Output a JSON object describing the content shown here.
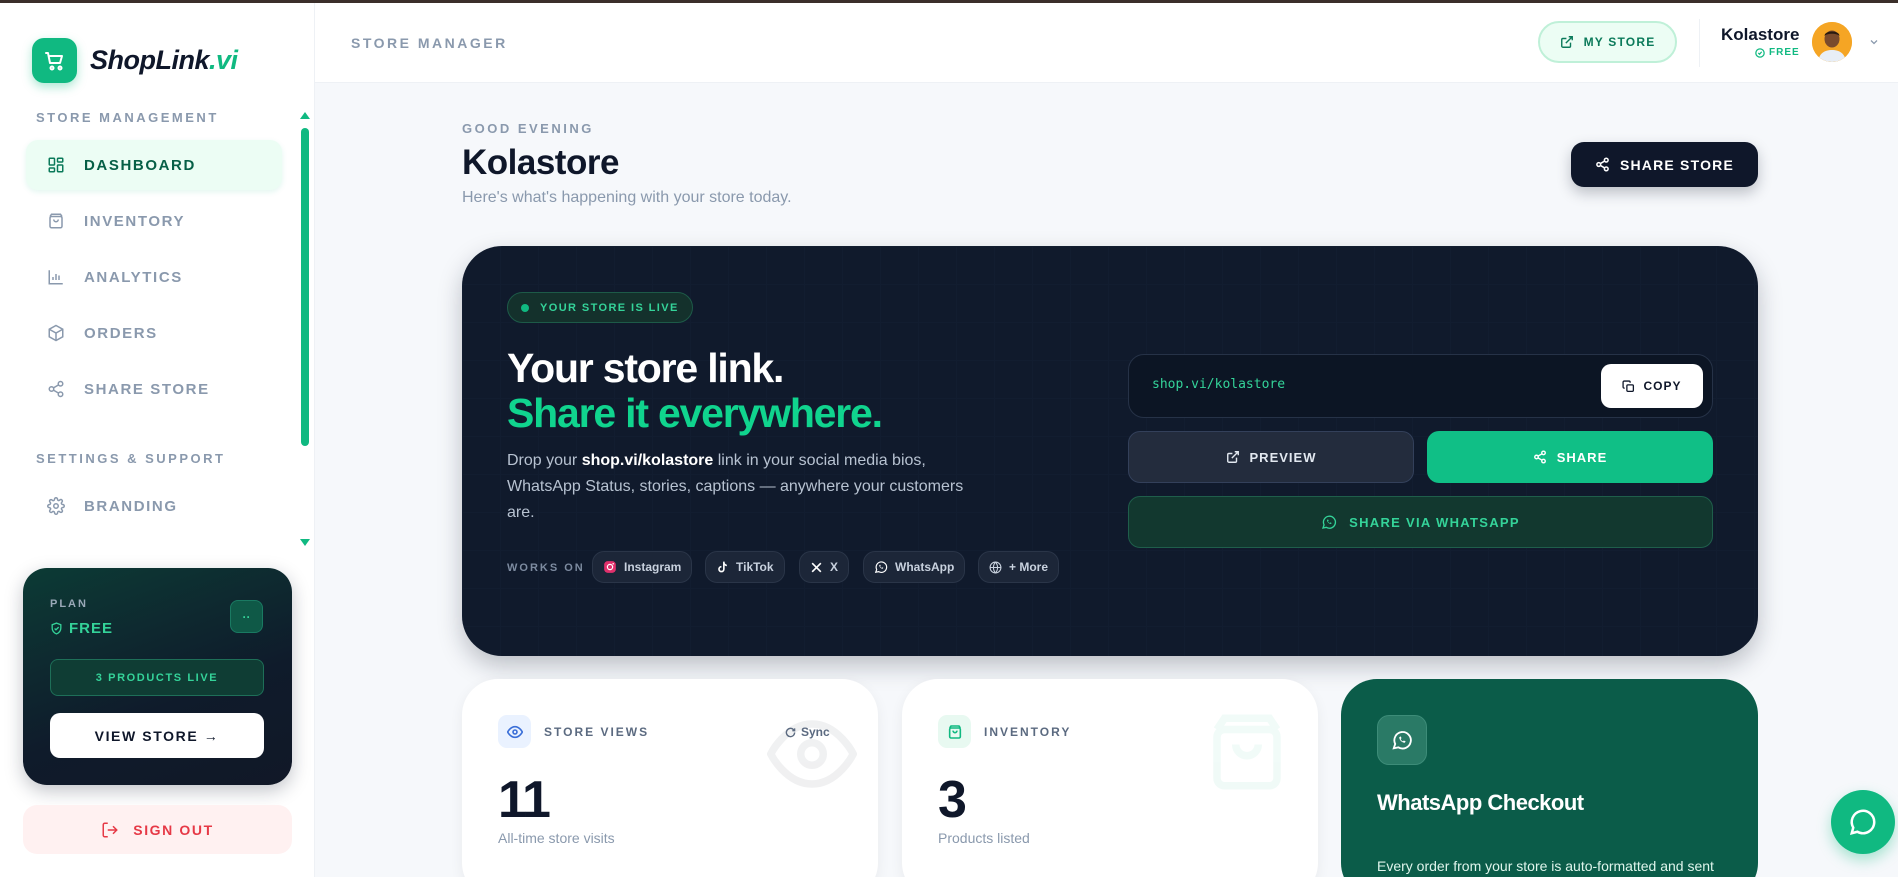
{
  "brand": {
    "name_main": "ShopLink",
    "name_accent": ".vi",
    "accent_color": "#10b981",
    "dark_color": "#0f172a"
  },
  "sidebar": {
    "section_store": "STORE MANAGEMENT",
    "section_settings": "SETTINGS & SUPPORT",
    "items": [
      {
        "label": "DASHBOARD",
        "icon": "grid-icon",
        "active": true
      },
      {
        "label": "INVENTORY",
        "icon": "bag-icon",
        "active": false
      },
      {
        "label": "ANALYTICS",
        "icon": "bar-chart-icon",
        "active": false
      },
      {
        "label": "ORDERS",
        "icon": "box-icon",
        "active": false
      },
      {
        "label": "SHARE STORE",
        "icon": "share-icon",
        "active": false
      }
    ],
    "settings_items": [
      {
        "label": "BRANDING",
        "icon": "gear-icon"
      }
    ],
    "plan": {
      "label": "PLAN",
      "name": "FREE",
      "button_glyph": "··",
      "products_live": "3 PRODUCTS LIVE",
      "view_store": "VIEW STORE →"
    },
    "sign_out": "SIGN OUT"
  },
  "topbar": {
    "breadcrumb": "STORE MANAGER",
    "my_store": "MY STORE",
    "user_name": "Kolastore",
    "user_plan": "FREE"
  },
  "main": {
    "greeting": "GOOD EVENING",
    "title": "Kolastore",
    "subtitle": "Here's what's happening with your store today.",
    "share_store": "SHARE STORE"
  },
  "hero": {
    "badge": "YOUR STORE IS LIVE",
    "headline_1": "Your store link.",
    "headline_2": "Share it everywhere.",
    "desc_pre": "Drop your ",
    "desc_link": "shop.vi/kolastore",
    "desc_post": " link in your social media bios, WhatsApp Status, stories, captions — anywhere your customers are.",
    "works_on": "WORKS ON",
    "platforms": [
      {
        "label": "Instagram",
        "icon": "instagram-icon"
      },
      {
        "label": "TikTok",
        "icon": "tiktok-icon"
      },
      {
        "label": "X",
        "icon": "x-icon"
      },
      {
        "label": "WhatsApp",
        "icon": "whatsapp-icon"
      },
      {
        "label": "+ More",
        "icon": "globe-icon"
      }
    ],
    "store_link": "shop.vi/kolastore",
    "copy": "COPY",
    "preview": "PREVIEW",
    "share": "SHARE",
    "share_whatsapp": "SHARE VIA WHATSAPP"
  },
  "stats": [
    {
      "label": "STORE VIEWS",
      "value": "11",
      "sub": "All-time store visits",
      "icon": "eye-icon",
      "action": "Sync"
    },
    {
      "label": "INVENTORY",
      "value": "3",
      "sub": "Products listed",
      "icon": "bag-icon"
    }
  ],
  "whatsapp_card": {
    "title": "WhatsApp Checkout",
    "text": "Every order from your store is auto-formatted and sent"
  }
}
